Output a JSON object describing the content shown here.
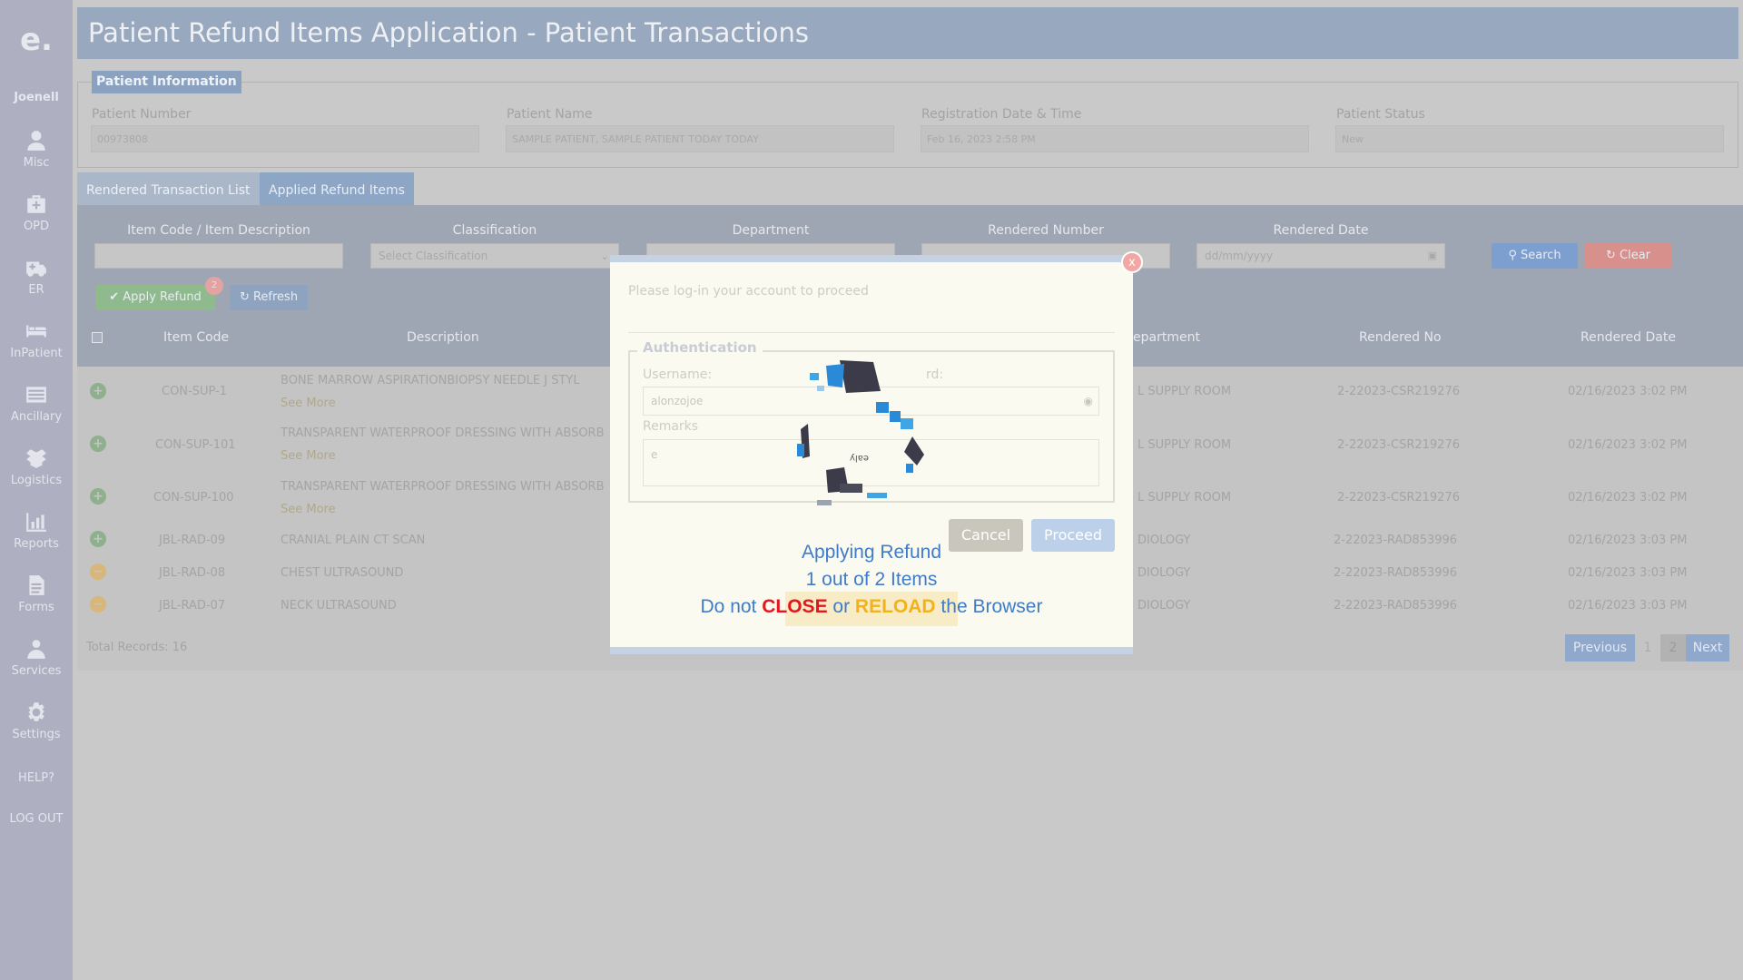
{
  "app": {
    "title": "Patient Refund Items Application - Patient Transactions",
    "user": "Joenell"
  },
  "sidebar": {
    "items": [
      {
        "label": "Misc",
        "icon": "user-icon"
      },
      {
        "label": "OPD",
        "icon": "medkit-icon"
      },
      {
        "label": "ER",
        "icon": "ambulance-icon"
      },
      {
        "label": "InPatient",
        "icon": "bed-icon"
      },
      {
        "label": "Ancillary",
        "icon": "list-icon"
      },
      {
        "label": "Logistics",
        "icon": "box-icon"
      },
      {
        "label": "Reports",
        "icon": "bar-chart-icon"
      },
      {
        "label": "Forms",
        "icon": "file-icon"
      },
      {
        "label": "Services",
        "icon": "services-icon"
      },
      {
        "label": "Settings",
        "icon": "gear-icon"
      }
    ],
    "help": "HELP?",
    "logout": "LOG OUT"
  },
  "patient_info": {
    "legend": "Patient Information",
    "fields": [
      {
        "label": "Patient Number",
        "value": "00973808"
      },
      {
        "label": "Patient Name",
        "value": "SAMPLE PATIENT, SAMPLE PATIENT TODAY TODAY"
      },
      {
        "label": "Registration Date & Time",
        "value": "Feb 16, 2023 2:58 PM"
      },
      {
        "label": "Patient Status",
        "value": "New"
      }
    ]
  },
  "tabs": {
    "tab1": "Rendered Transaction List",
    "tab2": "Applied Refund Items"
  },
  "filters": {
    "item_code_label": "Item Code / Item Description",
    "classification_label": "Classification",
    "classification_value": "Select Classification",
    "department_label": "Department",
    "rendered_number_label": "Rendered Number",
    "rendered_date_label": "Rendered Date",
    "rendered_date_placeholder": "dd/mm/yyyy",
    "search": "Search",
    "clear": "Clear",
    "apply_refund": "Apply Refund",
    "apply_badge": "2",
    "refresh": "Refresh"
  },
  "table": {
    "headers": {
      "item_code": "Item Code",
      "description": "Description",
      "department": "epartment",
      "rendered_no": "Rendered No",
      "rendered_date": "Rendered Date"
    },
    "rows": [
      {
        "code": "CON-SUP-1",
        "desc": "BONE MARROW ASPIRATIONBIOPSY NEEDLE J STYL",
        "see_more": "See More",
        "dept": "L SUPPLY ROOM",
        "no": "2-22023-CSR219276",
        "date": "02/16/2023 3:02 PM",
        "status": "add"
      },
      {
        "code": "CON-SUP-101",
        "desc": "TRANSPARENT WATERPROOF DRESSING WITH ABSORB",
        "see_more": "See More",
        "dept": "L SUPPLY ROOM",
        "no": "2-22023-CSR219276",
        "date": "02/16/2023 3:02 PM",
        "status": "add"
      },
      {
        "code": "CON-SUP-100",
        "desc": "TRANSPARENT WATERPROOF DRESSING WITH ABSORB",
        "see_more": "See More",
        "dept": "L SUPPLY ROOM",
        "no": "2-22023-CSR219276",
        "date": "02/16/2023 3:02 PM",
        "status": "add"
      },
      {
        "code": "JBL-RAD-09",
        "desc": "CRANIAL PLAIN CT SCAN",
        "see_more": "",
        "dept": "DIOLOGY",
        "no": "2-22023-RAD853996",
        "date": "02/16/2023 3:03 PM",
        "status": "add"
      },
      {
        "code": "JBL-RAD-08",
        "desc": "CHEST ULTRASOUND",
        "see_more": "",
        "dept": "DIOLOGY",
        "no": "2-22023-RAD853996",
        "date": "02/16/2023 3:03 PM",
        "status": "remove"
      },
      {
        "code": "JBL-RAD-07",
        "desc": "NECK ULTRASOUND",
        "see_more": "",
        "dept": "DIOLOGY",
        "no": "2-22023-RAD853996",
        "date": "02/16/2023 3:03 PM",
        "status": "remove"
      }
    ],
    "total": "Total Records: 16"
  },
  "pager": {
    "previous": "Previous",
    "p1": "1",
    "p2": "2",
    "next": "Next"
  },
  "modal": {
    "close": "x",
    "prompt": "Please log-in your account to proceed",
    "auth_legend": "Authentication",
    "username_label": "Username:",
    "password_label_partial": "rd:",
    "username_value": "alonzojoe",
    "remarks_label": "Remarks",
    "remarks_value": "e",
    "cancel": "Cancel",
    "proceed": "Proceed",
    "loader_caption": "ealy",
    "loading_line1": "Applying Refund",
    "loading_line2": "1 out of 2 Items",
    "warn_prefix": "Do not ",
    "warn_close": "CLOSE",
    "warn_or": " or ",
    "warn_reload": "RELOAD",
    "warn_suffix": " the Browser"
  }
}
